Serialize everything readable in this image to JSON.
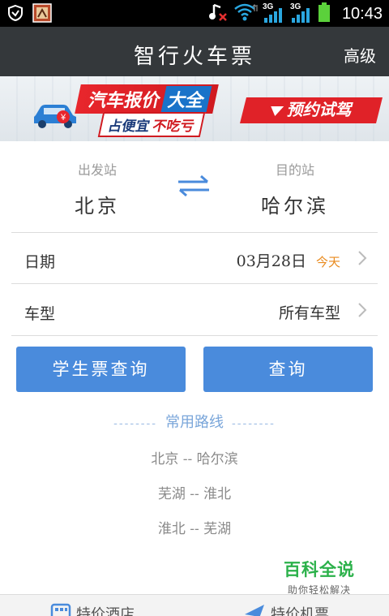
{
  "status_bar": {
    "time": "10:43",
    "network_left": "3G",
    "network_right": "3G",
    "icons": [
      "shield-icon",
      "app-thumbnail-icon",
      "music-muted-icon",
      "wifi-icon",
      "signal-icon",
      "battery-icon"
    ]
  },
  "header": {
    "title": "智行火车票",
    "advanced_label": "高级"
  },
  "banner": {
    "headline": "汽车报价",
    "headline_highlight": "大全",
    "subline": "占便宜",
    "subline_highlight": "不吃亏",
    "cta": "预约试驾",
    "car_badge": "¥"
  },
  "stations": {
    "from_label": "出发站",
    "from_value": "北京",
    "to_label": "目的站",
    "to_value": "哈尔滨"
  },
  "date_row": {
    "label": "日期",
    "value": "03月28日",
    "today": "今天"
  },
  "train_type_row": {
    "label": "车型",
    "value": "所有车型"
  },
  "buttons": {
    "student": "学生票查询",
    "search": "查询"
  },
  "frequent": {
    "title": "常用路线",
    "dashes": "--------",
    "routes": [
      "北京 -- 哈尔滨",
      "芜湖 -- 淮北",
      "淮北 -- 芜湖"
    ]
  },
  "watermark": {
    "main": "百科全说",
    "sub": "助你轻松解决"
  },
  "tabbar": {
    "left": "特价酒店",
    "right": "特价机票"
  },
  "colors": {
    "header_bg": "#34383b",
    "button_bg": "#4a8bdc",
    "accent_orange": "#e98a1d",
    "route_title": "#7aa6da"
  }
}
